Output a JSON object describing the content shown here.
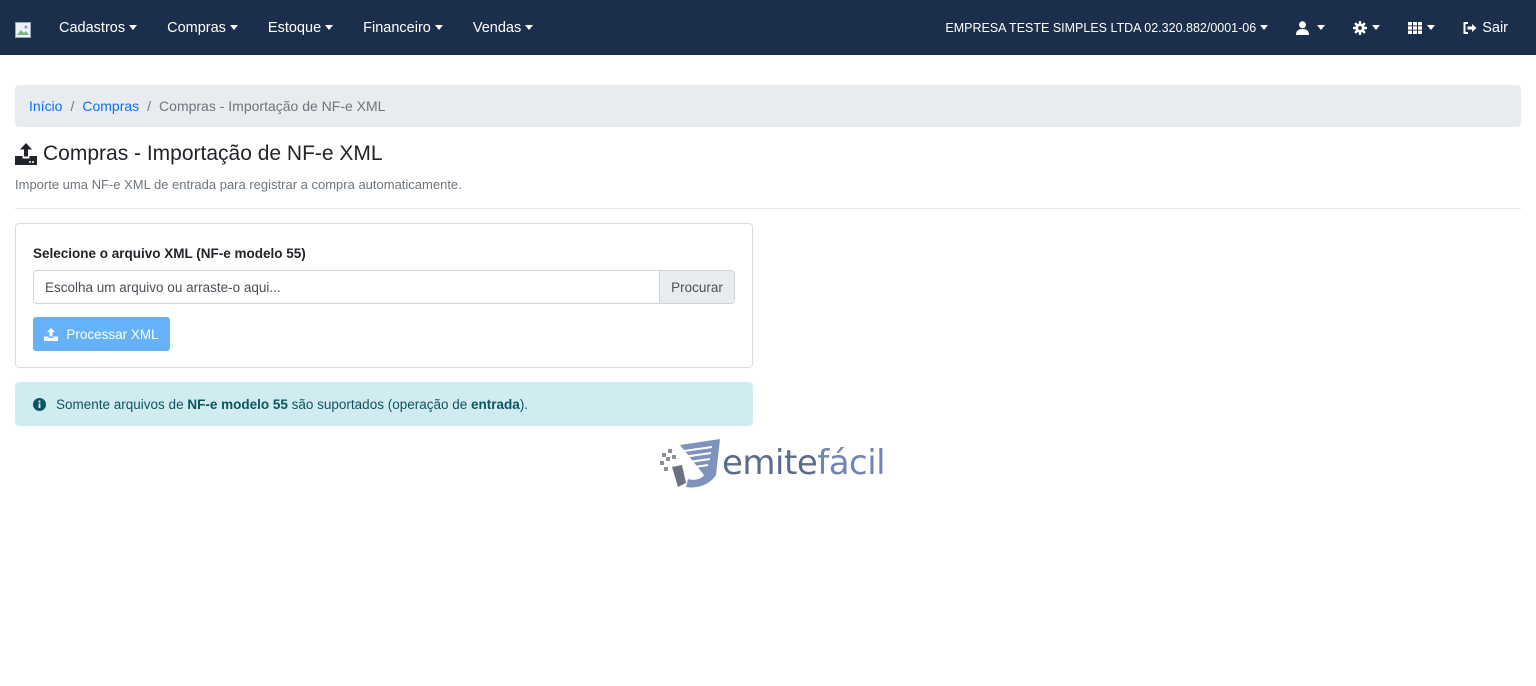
{
  "navbar": {
    "menu": [
      {
        "label": "Cadastros"
      },
      {
        "label": "Compras"
      },
      {
        "label": "Estoque"
      },
      {
        "label": "Financeiro"
      },
      {
        "label": "Vendas"
      }
    ],
    "company": "EMPRESA TESTE SIMPLES LTDA 02.320.882/0001-06",
    "logout_label": "Sair",
    "icons": [
      "user-icon",
      "gear-icon",
      "apps-grid-icon",
      "logout-icon"
    ]
  },
  "breadcrumb": {
    "items": [
      {
        "label": "Início"
      },
      {
        "label": "Compras"
      }
    ],
    "active": "Compras - Importação de NF-e XML"
  },
  "page": {
    "title": "Compras - Importação de NF-e XML",
    "subtitle": "Importe uma NF-e XML de entrada para registrar a compra automaticamente."
  },
  "form": {
    "label": "Selecione o arquivo XML (NF-e modelo 55)",
    "file_placeholder": "Escolha um arquivo ou arraste-o aqui...",
    "browse_label": "Procurar",
    "submit_label": "Processar XML"
  },
  "alert": {
    "prefix": "Somente arquivos de",
    "strong1": "NF-e modelo 55",
    "middle": "são suportados (operação de",
    "strong2": "entrada",
    "suffix": ")."
  },
  "logo": {
    "part1": "emite",
    "part2": "fácil"
  },
  "colors": {
    "navbar": "#1b2e4b",
    "link": "#0d6efd",
    "button": "#66b2f8",
    "alert_bg": "#d1ecf1"
  }
}
